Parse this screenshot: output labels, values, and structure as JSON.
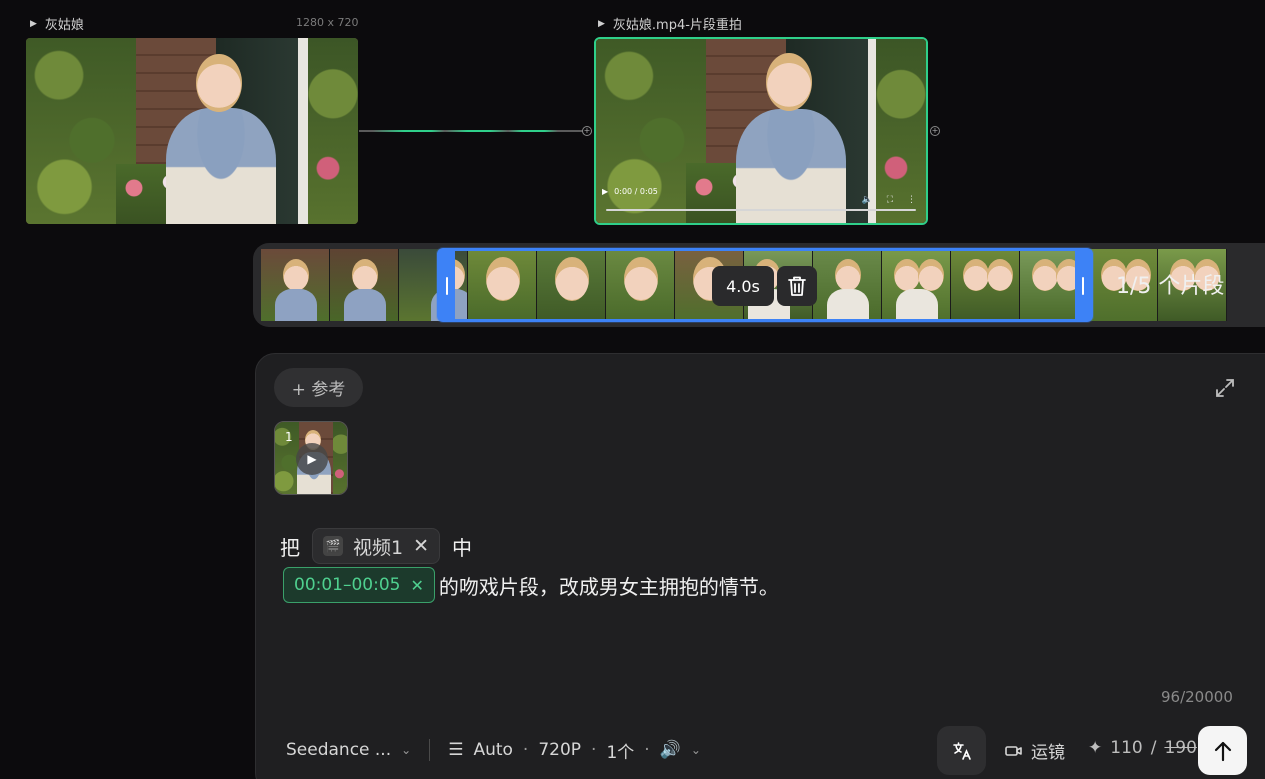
{
  "source_node": {
    "title": "灰姑娘",
    "dimensions": "1280 x 720"
  },
  "output_node": {
    "title": "灰姑娘.mp4-片段重拍",
    "time": "0:00 / 0:05"
  },
  "timeline": {
    "duration_label": "4.0s",
    "segment_count": "1/5 个片段"
  },
  "prompt": {
    "reference_button": "+ 参考",
    "thumb_index": "1",
    "text_before": "把",
    "video_chip": "视频1",
    "text_mid": "中",
    "time_range": "00:01–00:05",
    "text_after": "的吻戏片段，改成男女主拥抱的情节。",
    "char_counter": "96/20000"
  },
  "toolbar": {
    "model": "Seedance ...",
    "ratio": "Auto",
    "resolution": "720P",
    "count": "1个",
    "camera": "运镜",
    "credits_new": "110",
    "credits_old": "190"
  },
  "colors": {
    "accent_green": "#2fd08a",
    "selection_blue": "#3d82f6",
    "panel_bg": "#1f1f21"
  },
  "icons": [
    "play-triangle-icon",
    "port-icon",
    "trash-icon",
    "expand-icon",
    "play-icon",
    "clapper-icon",
    "close-icon",
    "settings-sliders-icon",
    "speaker-icon",
    "chevron-down-icon",
    "translate-icon",
    "camera-icon",
    "sparkle-icon",
    "arrow-up-icon"
  ]
}
